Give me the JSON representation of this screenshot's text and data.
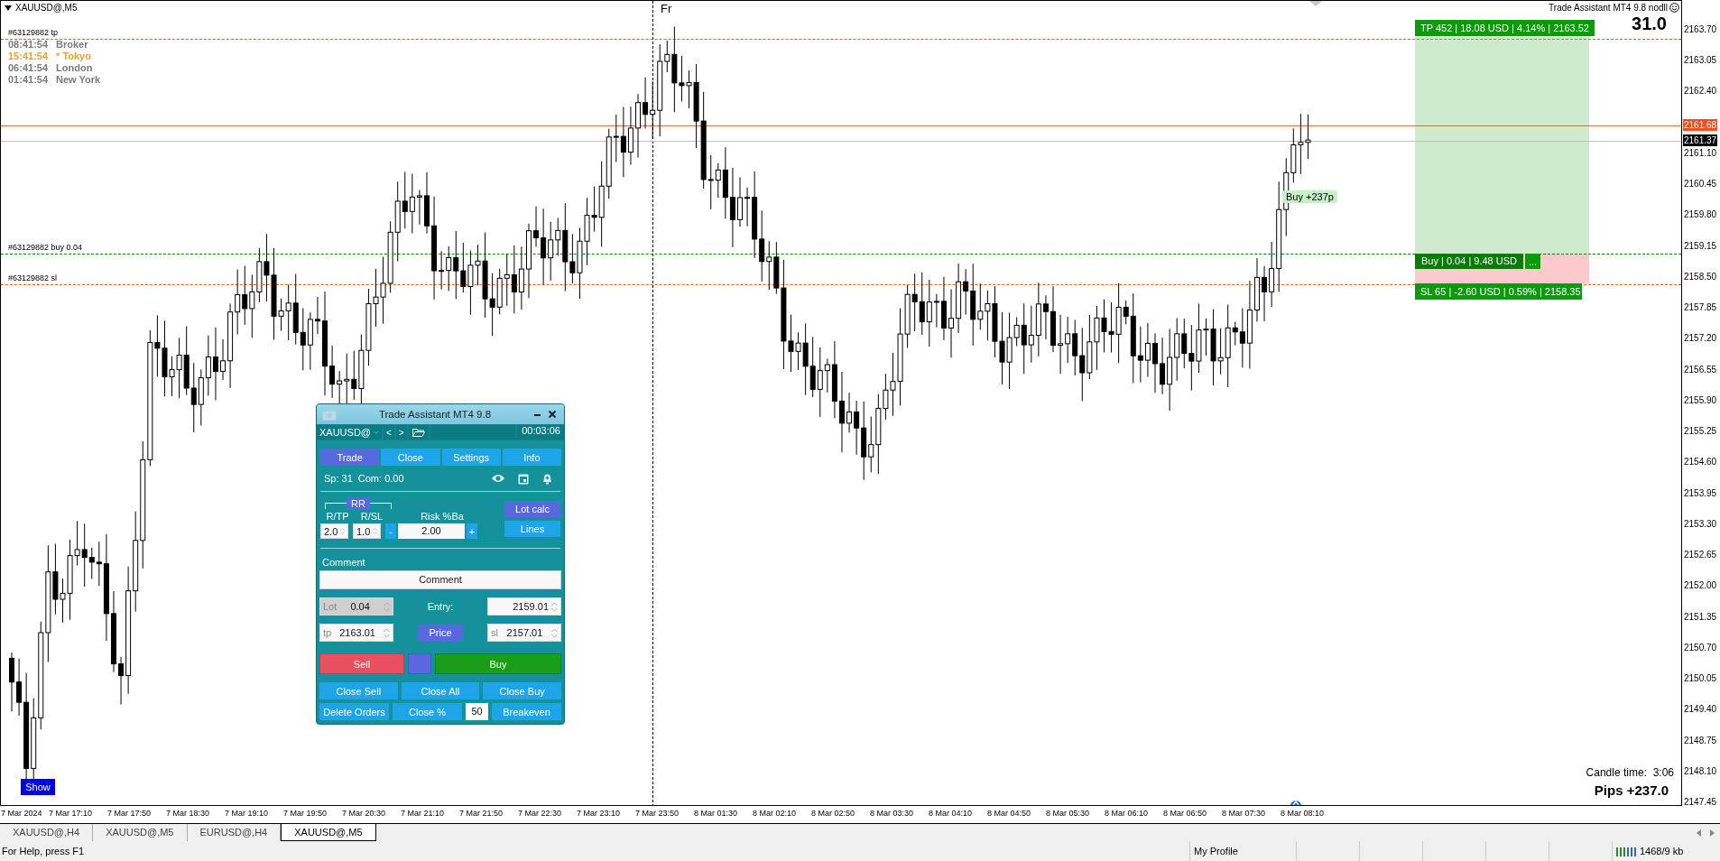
{
  "chart": {
    "symbol_title": "XAUUSD@,M5",
    "day_marker": "Fr",
    "order_lines": [
      {
        "kind": "tp",
        "label": "#63129882 tp",
        "color": "#e0601a"
      },
      {
        "kind": "buy",
        "label": "#63129882 buy 0.04",
        "color": "#1a7a1a"
      },
      {
        "kind": "sl",
        "label": "#63129882 sl",
        "color": "#e0601a"
      }
    ],
    "clocks": [
      {
        "time": "08:41:54",
        "city": "Broker",
        "color": "#7a7a7a"
      },
      {
        "time": "15:41:54",
        "city": "* Tokyo",
        "color": "#f0a030"
      },
      {
        "time": "06:41:54",
        "city": "London",
        "color": "#7a7a7a"
      },
      {
        "time": "01:41:54",
        "city": "New York",
        "color": "#7a7a7a"
      }
    ],
    "price_lines": [
      {
        "kind": "ask",
        "price": "2161.68"
      },
      {
        "kind": "bid",
        "price": "2161.37"
      }
    ],
    "position_box": {
      "tp_label": "TP 452 | 18.08 USD | 4.14% | 2163.52",
      "entry_label": "Buy | 0.04 | 9.48 USD",
      "entry_button": "...",
      "sl_label": "SL 65 | -2.60 USD | 0.59% | 2158.35"
    },
    "trade_marker": "Buy +237p",
    "indicator_label": "Trade Assistant MT4 9.8 nodll",
    "spread": "31.0",
    "show_button": "Show",
    "candle_time": "Candle time:  3:06",
    "pips": "Pips +237.0",
    "price_axis": [
      "2163.70",
      "2163.05",
      "2162.40",
      "2161.10",
      "2160.45",
      "2159.80",
      "2159.15",
      "2158.50",
      "2157.85",
      "2157.20",
      "2156.55",
      "2155.90",
      "2155.25",
      "2154.60",
      "2153.95",
      "2153.30",
      "2152.65",
      "2152.00",
      "2151.35",
      "2150.70",
      "2150.05",
      "2149.40",
      "2148.75",
      "2148.10",
      "2147.45"
    ],
    "time_axis": [
      "7 Mar 2024",
      "7 Mar 17:10",
      "7 Mar 17:50",
      "7 Mar 18:30",
      "7 Mar 19:10",
      "7 Mar 19:50",
      "7 Mar 20:30",
      "7 Mar 21:10",
      "7 Mar 21:50",
      "7 Mar 22:30",
      "7 Mar 23:10",
      "7 Mar 23:50",
      "8 Mar 01:30",
      "8 Mar 02:10",
      "8 Mar 02:50",
      "8 Mar 03:30",
      "8 Mar 04:10",
      "8 Mar 04:50",
      "8 Mar 05:30",
      "8 Mar 06:10",
      "8 Mar 06:50",
      "8 Mar 07:30",
      "8 Mar 08:10"
    ]
  },
  "panel": {
    "title": "Trade Assistant MT4 9.8",
    "symbol": "XAUUSD@",
    "prev": "<",
    "next": ">",
    "timer": "00:03:06",
    "tabs": [
      {
        "label": "Trade",
        "selected": true
      },
      {
        "label": "Close",
        "selected": false
      },
      {
        "label": "Settings",
        "selected": false
      },
      {
        "label": "Info",
        "selected": false
      }
    ],
    "spread": "Sp: 31",
    "commission": "Com: 0.00",
    "rr_label": "RR",
    "rtp_label": "R/TP",
    "rsl_label": "R/SL",
    "risk_label": "Risk %Ba",
    "rtp_value": "2.0",
    "rsl_value": "1.0",
    "minus": "-",
    "risk_value": "2.00",
    "plus": "+",
    "lot_calc": "Lot calc",
    "lines": "Lines",
    "comment_label": "Comment",
    "comment_value": "Comment",
    "lot": {
      "prefix": "Lot",
      "value": "0.04",
      "disabled": true
    },
    "entry_label": "Entry:",
    "entry_value": "2159.01",
    "tp": {
      "prefix": "tp",
      "value": "2163.01"
    },
    "price_button": "Price",
    "sl": {
      "prefix": "sl",
      "value": "2157.01"
    },
    "sell": "Sell",
    "buy": "Buy",
    "action_rows": [
      [
        {
          "kind": "button",
          "label": "Close Sell"
        },
        {
          "kind": "button",
          "label": "Close All"
        },
        {
          "kind": "button",
          "label": "Close Buy"
        }
      ],
      [
        {
          "kind": "button",
          "label": "Delete Orders"
        },
        {
          "kind": "button",
          "label": "Close %"
        },
        {
          "kind": "field",
          "label": "50"
        },
        {
          "kind": "button",
          "label": "Breakeven"
        }
      ]
    ]
  },
  "tabs": [
    {
      "label": "XAUUSD@,H4",
      "selected": false
    },
    {
      "label": "XAUUSD@,M5",
      "selected": false
    },
    {
      "label": "EURUSD@,H4",
      "selected": false
    },
    {
      "label": "XAUUSD@,M5",
      "selected": true
    }
  ],
  "status_bar": {
    "help": "For Help, press F1",
    "profile": "My Profile",
    "traffic": "1468/9 kb"
  }
}
